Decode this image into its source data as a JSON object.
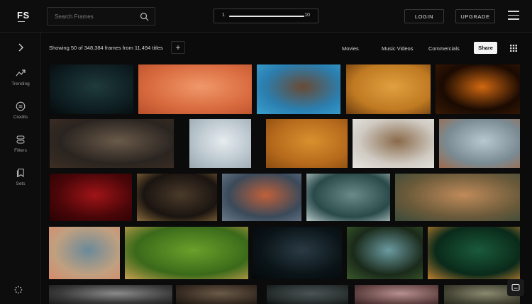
{
  "header": {
    "logo": "FS",
    "search_placeholder": "Search Frames",
    "slider": {
      "min_label": "1",
      "max_label": "10",
      "value_fraction": 1.0
    },
    "login_label": "LOGIN",
    "upgrade_label": "UPGRADE"
  },
  "sidebar": {
    "items": [
      {
        "label": "Trending",
        "icon": "trending-icon"
      },
      {
        "label": "Credits",
        "icon": "credits-icon"
      },
      {
        "label": "Filters",
        "icon": "filters-icon"
      },
      {
        "label": "Sets",
        "icon": "sets-icon"
      }
    ]
  },
  "toolbar": {
    "showing_text": "Showing 50 of 348,384 frames from 11,494 titles",
    "plus_label": "+",
    "filters": [
      "Movies",
      "Music Videos",
      "Commercials"
    ],
    "share_label": "Share"
  },
  "frames": [
    {
      "name": "frame-stage-spotlight",
      "colors": [
        "#0e1e22",
        "#1f3a3a",
        "#06090a"
      ]
    },
    {
      "name": "frame-orange-room",
      "colors": [
        "#d86a3e",
        "#f0986a",
        "#b8502c"
      ]
    },
    {
      "name": "frame-closeup-face",
      "colors": [
        "#2a7fb0",
        "#6a4a34",
        "#3aa0d0"
      ]
    },
    {
      "name": "frame-shadow-hand",
      "colors": [
        "#c07a22",
        "#e0a040",
        "#6a3c10"
      ]
    },
    {
      "name": "frame-silhouette-orange",
      "colors": [
        "#1a0a02",
        "#d06810",
        "#3a1a04"
      ]
    },
    {
      "name": "frame-bedroom-floor",
      "colors": [
        "#2a2420",
        "#6a5a4a",
        "#3e2e24"
      ]
    },
    {
      "name": "frame-white-room",
      "colors": [
        "#b8c4cc",
        "#e6ecef",
        "#9aa8b0"
      ]
    },
    {
      "name": "frame-orange-fabric",
      "colors": [
        "#b66a1c",
        "#d8902e",
        "#8a4c10"
      ]
    },
    {
      "name": "frame-studio-backdrop",
      "colors": [
        "#cfcac2",
        "#8a6a4a",
        "#e8e6e2"
      ]
    },
    {
      "name": "frame-window-desk",
      "colors": [
        "#7a8a92",
        "#b8c8d0",
        "#a06a4a"
      ]
    },
    {
      "name": "frame-red-closeup",
      "colors": [
        "#4a0608",
        "#a01418",
        "#2a0204"
      ]
    },
    {
      "name": "frame-bar-interior",
      "colors": [
        "#1a1410",
        "#4a3a2a",
        "#8a6a3a"
      ]
    },
    {
      "name": "frame-redhead-woman",
      "colors": [
        "#3a4a5a",
        "#c0603a",
        "#6a7a8a"
      ]
    },
    {
      "name": "frame-office-cubicles",
      "colors": [
        "#2a4a4a",
        "#6a8a8a",
        "#b8c8c8"
      ]
    },
    {
      "name": "frame-two-men",
      "colors": [
        "#6a5a3a",
        "#c08a5a",
        "#3a4a3a"
      ]
    },
    {
      "name": "frame-curly-woman",
      "colors": [
        "#c0a080",
        "#6a8a9a",
        "#d88a6a"
      ]
    },
    {
      "name": "frame-golf-green",
      "colors": [
        "#3a6a1a",
        "#6aa02a",
        "#c8a050"
      ]
    },
    {
      "name": "frame-dark-window",
      "colors": [
        "#0a1418",
        "#2a3a44",
        "#05080a"
      ]
    },
    {
      "name": "frame-doorway-figure",
      "colors": [
        "#1a2a1a",
        "#6a9aa0",
        "#3a5a2a"
      ]
    },
    {
      "name": "frame-porthole",
      "colors": [
        "#0a2a1a",
        "#1a5a3a",
        "#c08030"
      ]
    },
    {
      "name": "frame-bottom-1",
      "colors": [
        "#3a3a3a",
        "#8a8a8a",
        "#1a1a1a"
      ]
    },
    {
      "name": "frame-bottom-2",
      "colors": [
        "#3a2e24",
        "#6a5a48",
        "#1a1612"
      ]
    },
    {
      "name": "frame-bottom-3",
      "colors": [
        "#2a3030",
        "#4a5454",
        "#0e1212"
      ]
    },
    {
      "name": "frame-bottom-4",
      "colors": [
        "#6a4a4a",
        "#b89090",
        "#3a2424"
      ]
    },
    {
      "name": "frame-bottom-5",
      "colors": [
        "#4a4a3a",
        "#8a8a70",
        "#2a2a1e"
      ]
    }
  ]
}
